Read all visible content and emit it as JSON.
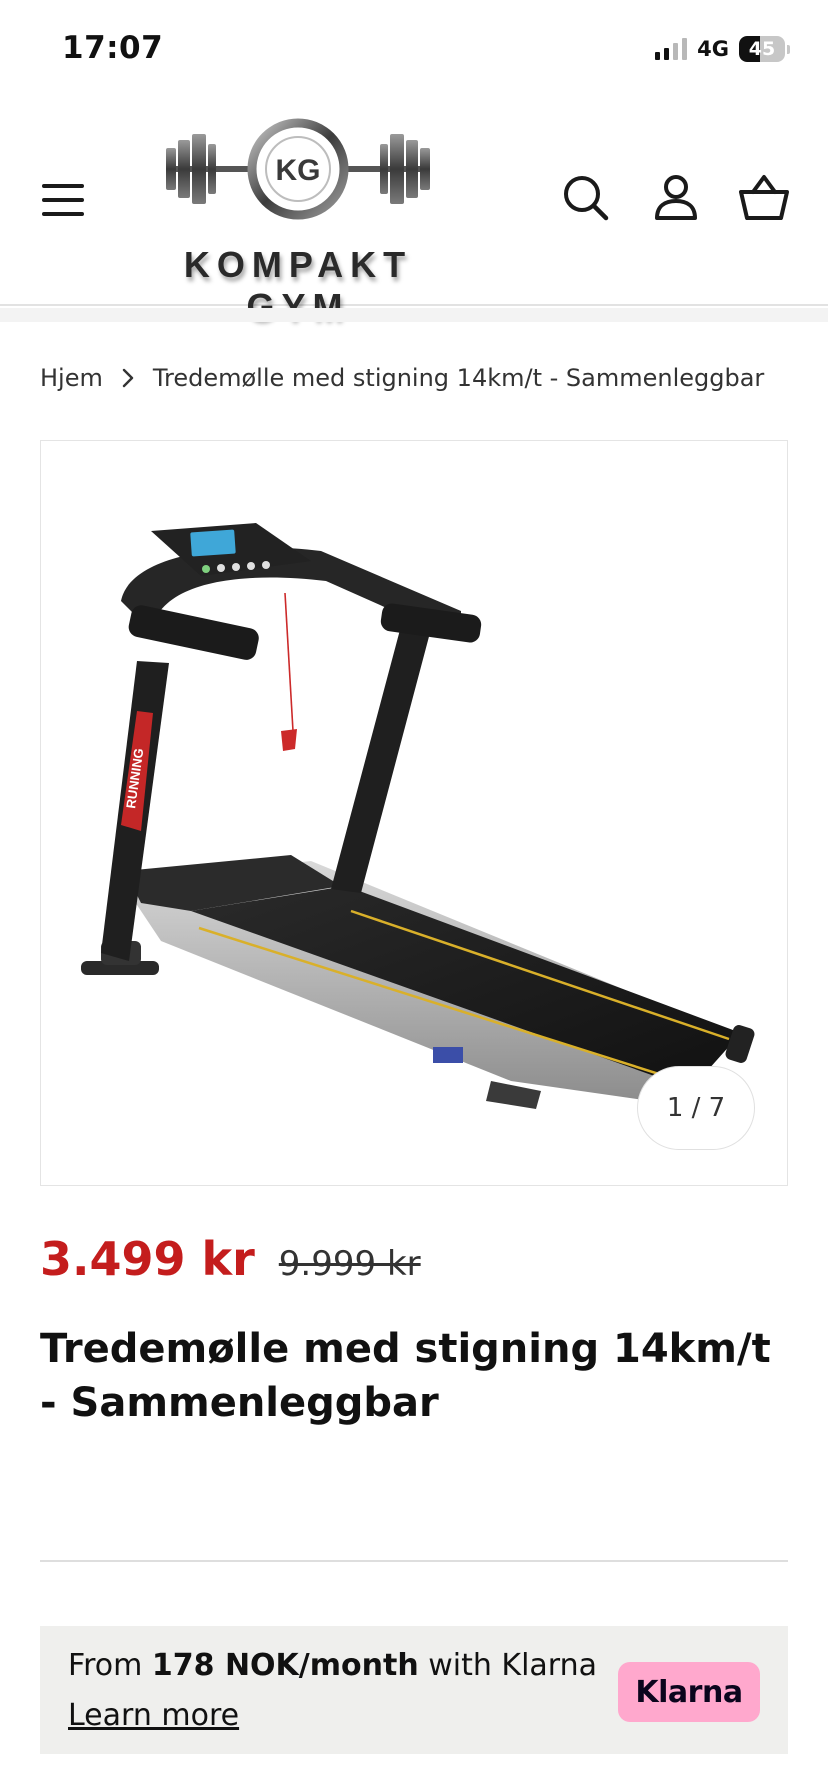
{
  "status_bar": {
    "time": "17:07",
    "network": "4G",
    "battery_level": "45",
    "battery_fraction": 0.45,
    "signal_bars_active": 2,
    "signal_bars_total": 4
  },
  "header": {
    "brand_name": "KOMPAKT GYM",
    "logo_monogram": "KG",
    "icons": {
      "menu": "hamburger-menu-icon",
      "search": "search-icon",
      "account": "account-icon",
      "cart": "basket-icon"
    }
  },
  "breadcrumb": {
    "home_label": "Hjem",
    "current_label": "Tredemølle med stigning 14km/t - Sammenleggbar"
  },
  "gallery": {
    "image_alt": "treadmill-product-photo",
    "counter": "1 / 7"
  },
  "price": {
    "sale": "3.499 kr",
    "compare_at": "9.999 kr"
  },
  "product": {
    "title": "Tredemølle med stigning 14km/t - Sammenleggbar"
  },
  "klarna": {
    "prefix": "From",
    "amount": "178 NOK/month",
    "suffix": "with Klarna",
    "learn_more": "Learn more",
    "badge_label": "Klarna"
  },
  "colors": {
    "sale_price": "#c41d1d",
    "klarna_pink": "#ffa8cd",
    "klarna_box_bg": "#efefed"
  }
}
